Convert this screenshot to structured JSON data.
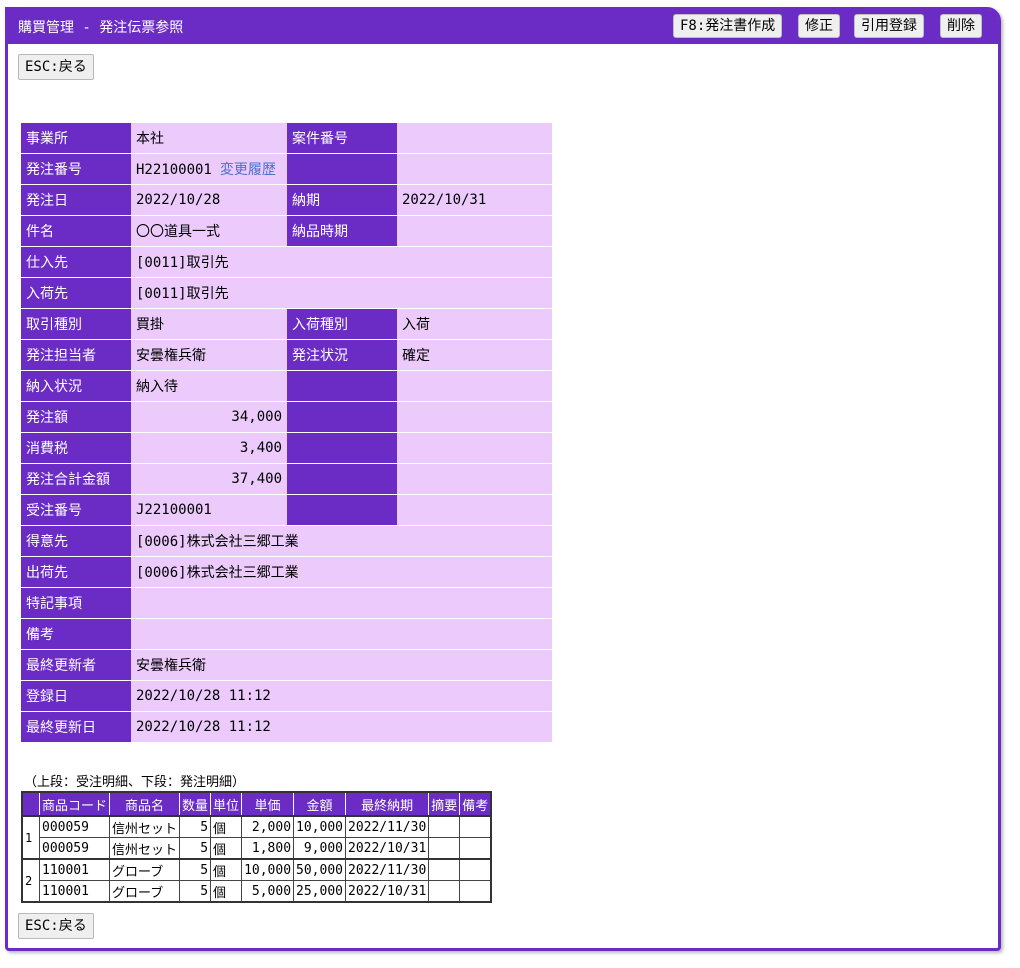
{
  "header": {
    "title": "購買管理 - 発注伝票参照",
    "buttons": {
      "f8": "F8:発注書作成",
      "edit": "修正",
      "copy": "引用登録",
      "delete": "削除"
    }
  },
  "esc_label": "ESC:戻る",
  "info": {
    "office": {
      "label": "事業所",
      "value": "本社"
    },
    "case_no": {
      "label": "案件番号",
      "value": ""
    },
    "order_no": {
      "label": "発注番号",
      "value": "H22100001",
      "link": "変更履歴"
    },
    "order_date": {
      "label": "発注日",
      "value": "2022/10/28"
    },
    "due": {
      "label": "納期",
      "value": "2022/10/31"
    },
    "subject": {
      "label": "件名",
      "value": "〇〇道具一式"
    },
    "delivery_period": {
      "label": "納品時期",
      "value": ""
    },
    "supplier": {
      "label": "仕入先",
      "value": "[0011]取引先"
    },
    "receive_from": {
      "label": "入荷先",
      "value": "[0011]取引先"
    },
    "trade_type": {
      "label": "取引種別",
      "value": "買掛"
    },
    "receive_type": {
      "label": "入荷種別",
      "value": "入荷"
    },
    "person": {
      "label": "発注担当者",
      "value": "安曇権兵衛"
    },
    "order_status": {
      "label": "発注状況",
      "value": "確定"
    },
    "delivery_status": {
      "label": "納入状況",
      "value": "納入待"
    },
    "amount": {
      "label": "発注額",
      "value": "34,000"
    },
    "tax": {
      "label": "消費税",
      "value": "3,400"
    },
    "total": {
      "label": "発注合計金額",
      "value": "37,400"
    },
    "receipt_no": {
      "label": "受注番号",
      "value": "J22100001"
    },
    "customer": {
      "label": "得意先",
      "value": "[0006]株式会社三郷工業"
    },
    "ship_to": {
      "label": "出荷先",
      "value": "[0006]株式会社三郷工業"
    },
    "special": {
      "label": "特記事項",
      "value": ""
    },
    "memo": {
      "label": "備考",
      "value": ""
    },
    "updated_by": {
      "label": "最終更新者",
      "value": "安曇権兵衛"
    },
    "registered": {
      "label": "登録日",
      "value": "2022/10/28 11:12"
    },
    "updated": {
      "label": "最終更新日",
      "value": "2022/10/28 11:12"
    }
  },
  "detail": {
    "caption": "（上段：受注明細、下段：発注明細）",
    "columns": [
      "商品コード",
      "商品名",
      "数量",
      "単位",
      "単価",
      "金額",
      "最終納期",
      "摘要",
      "備考"
    ],
    "groups": [
      {
        "no": "1",
        "rows": [
          [
            "000059",
            "信州セット",
            "5",
            "個",
            "2,000",
            "10,000",
            "2022/11/30",
            "",
            ""
          ],
          [
            "000059",
            "信州セット",
            "5",
            "個",
            "1,800",
            "9,000",
            "2022/10/31",
            "",
            ""
          ]
        ]
      },
      {
        "no": "2",
        "rows": [
          [
            "110001",
            "グローブ",
            "5",
            "個",
            "10,000",
            "50,000",
            "2022/11/30",
            "",
            ""
          ],
          [
            "110001",
            "グローブ",
            "5",
            "個",
            "5,000",
            "25,000",
            "2022/10/31",
            "",
            ""
          ]
        ]
      }
    ]
  }
}
